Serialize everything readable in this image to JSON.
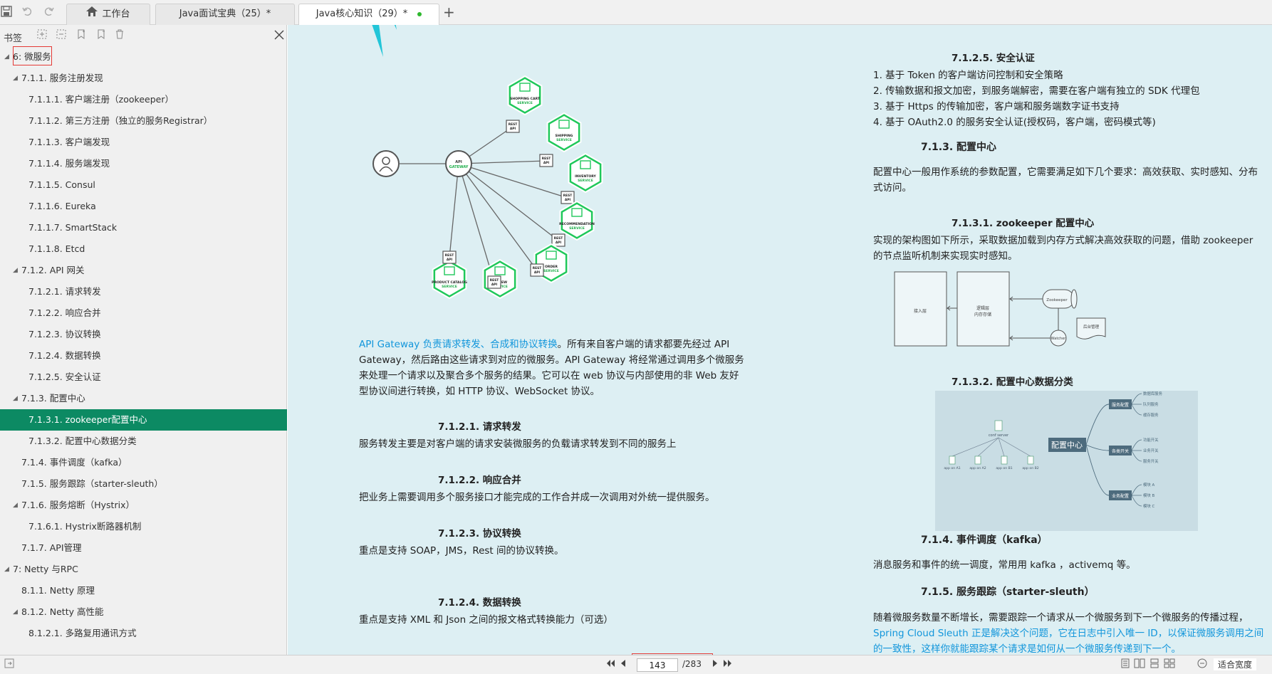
{
  "tabs": {
    "workbench": "工作台",
    "tab1": "Java面试宝典（25）*",
    "tab2": "Java核心知识（29）*"
  },
  "sidebar": {
    "title": "书签",
    "items": [
      {
        "label": "6:  微服务",
        "level": 0,
        "expanded": true
      },
      {
        "label": "7.1.1. 服务注册发现",
        "level": 1,
        "expanded": true
      },
      {
        "label": "7.1.1.1. 客户端注册（zookeeper）",
        "level": 2
      },
      {
        "label": "7.1.1.2. 第三方注册（独立的服务Registrar）",
        "level": 2
      },
      {
        "label": "7.1.1.3. 客户端发现",
        "level": 2
      },
      {
        "label": "7.1.1.4. 服务端发现",
        "level": 2
      },
      {
        "label": "7.1.1.5. Consul",
        "level": 2
      },
      {
        "label": "7.1.1.6. Eureka",
        "level": 2
      },
      {
        "label": "7.1.1.7. SmartStack",
        "level": 2
      },
      {
        "label": "7.1.1.8. Etcd",
        "level": 2
      },
      {
        "label": "7.1.2. API 网关",
        "level": 1,
        "expanded": true
      },
      {
        "label": "7.1.2.1. 请求转发",
        "level": 2
      },
      {
        "label": "7.1.2.2. 响应合并",
        "level": 2
      },
      {
        "label": "7.1.2.3. 协议转换",
        "level": 2
      },
      {
        "label": "7.1.2.4. 数据转换",
        "level": 2
      },
      {
        "label": "7.1.2.5. 安全认证",
        "level": 2
      },
      {
        "label": "7.1.3. 配置中心",
        "level": 1,
        "expanded": true
      },
      {
        "label": "7.1.3.1. zookeeper配置中心",
        "level": 2,
        "selected": true
      },
      {
        "label": "7.1.3.2. 配置中心数据分类",
        "level": 2
      },
      {
        "label": "7.1.4. 事件调度（kafka）",
        "level": 1
      },
      {
        "label": "7.1.5. 服务跟踪（starter-sleuth）",
        "level": 1
      },
      {
        "label": "7.1.6. 服务熔断（Hystrix）",
        "level": 1,
        "expanded": true
      },
      {
        "label": "7.1.6.1. Hystrix断路器机制",
        "level": 2
      },
      {
        "label": "7.1.7. API管理",
        "level": 1
      },
      {
        "label": "7: Netty 与RPC",
        "level": 0,
        "expanded": true
      },
      {
        "label": "8.1.1. Netty 原理",
        "level": 1
      },
      {
        "label": "8.1.2. Netty 高性能",
        "level": 1,
        "expanded": true
      },
      {
        "label": "8.1.2.1. 多路复用通讯方式",
        "level": 2
      }
    ]
  },
  "diagram": {
    "gateway": [
      "API",
      "GATEWAY"
    ],
    "rest": [
      "REST",
      "API"
    ],
    "services": [
      {
        "name": "SHOPPING CART",
        "sub": "SERVICE"
      },
      {
        "name": "SHIPPING",
        "sub": "SERVICE"
      },
      {
        "name": "INVENTORY",
        "sub": "SERVICE"
      },
      {
        "name": "RECOMMENDATION",
        "sub": "SERVICE"
      },
      {
        "name": "ORDER",
        "sub": "SERVICE"
      },
      {
        "name": "REVIEW",
        "sub": "SERVICE"
      },
      {
        "name": "PRODUCT CATALOG",
        "sub": "SERVICE"
      }
    ]
  },
  "left_col": {
    "para_link": "API Gateway 负责请求转发、合成和协议转换",
    "para_rest": "。所有来自客户端的请求都要先经过 API Gateway，然后路由这些请求到对应的微服务。API Gateway 将经常通过调用多个微服务来处理一个请求以及聚合多个服务的结果。它可以在 web 协议与内部使用的非 Web 友好型协议间进行转换，如 HTTP 协议、WebSocket 协议。",
    "s1_title": "7.1.2.1.      请求转发",
    "s1_body": "服务转发主要是对客户端的请求安装微服务的负载请求转发到不同的服务上",
    "s2_title": "7.1.2.2.      响应合并",
    "s2_body": "把业务上需要调用多个服务接口才能完成的工作合并成一次调用对外统一提供服务。",
    "s3_title": "7.1.2.3.      协议转换",
    "s3_body": "重点是支持 SOAP，JMS，Rest 间的协议转换。",
    "s4_title": "7.1.2.4.      数据转换",
    "s4_body": "重点是支持 XML 和 Json 之间的报文格式转换能力（可选）"
  },
  "right_col": {
    "sec_title": "7.1.2.5.      安全认证",
    "list": [
      "1.    基于 Token 的客户端访问控制和安全策略",
      "2.    传输数据和报文加密，到服务端解密，需要在客户端有独立的 SDK 代理包",
      "3.    基于 Https 的传输加密，客户端和服务端数字证书支持",
      "4.    基于 OAuth2.0 的服务安全认证(授权码，客户端，密码模式等)"
    ],
    "cfg_title": "7.1.3.  配置中心",
    "cfg_body": "配置中心一般用作系统的参数配置，它需要满足如下几个要求：高效获取、实时感知、分布式访问。",
    "zk_title": "7.1.3.1.      zookeeper 配置中心",
    "zk_body": "实现的架构图如下所示，采取数据加载到内存方式解决高效获取的问题，借助 zookeeper 的节点监听机制来实现实时感知。",
    "zk_diagram": {
      "box1": "接入层",
      "box2a": "逻辑层",
      "box2b": "内存存储",
      "zk": "Zookeeper",
      "watcher": "Watcher",
      "admin": "后台管理"
    },
    "cls_title": "7.1.3.2.      配置中心数据分类",
    "cls_diagram": {
      "center": "配置中心",
      "server": "conf server",
      "apps": [
        "app on A1",
        "app on A2",
        "app on B1",
        "app on B2"
      ],
      "groups": [
        {
          "name": "服务配置",
          "items": [
            "数据库服务",
            "队列服务",
            "缓存服务"
          ]
        },
        {
          "name": "各类开关",
          "items": [
            "功能开关",
            "业务开关",
            "服务开关"
          ]
        },
        {
          "name": "业务配置",
          "items": [
            "模块 A",
            "模块 B",
            "模块 C"
          ]
        }
      ]
    },
    "kafka_title": "7.1.4.  事件调度（kafka）",
    "kafka_body": "消息服务和事件的统一调度，常用用 kafka ，activemq 等。",
    "sleuth_title": "7.1.5.  服务跟踪（starter-sleuth）",
    "sleuth_body": " 随着微服务数量不断增长，需要跟踪一个请求从一个微服务到下一个微服务的传播过程，",
    "sleuth_link": "Spring Cloud Sleuth 正是解决这个问题，它在日志中引入唯一 ID，以保证微服务调用之间的一致性，这样你就能跟踪某个请求是如何从一个微服务传递到下一个。"
  },
  "status": {
    "page": "143",
    "total": "/283",
    "zoom_label": "适合宽度"
  }
}
